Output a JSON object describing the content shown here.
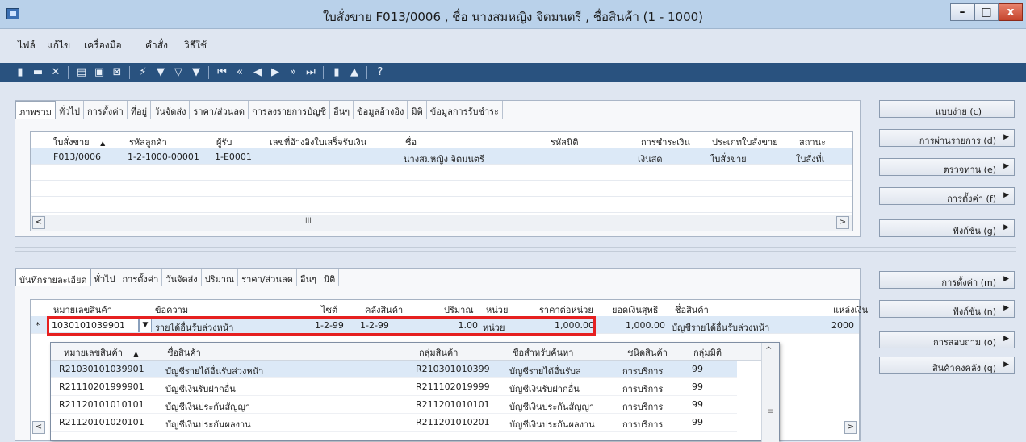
{
  "window": {
    "title": "ใบสั่งขาย F013/0006 , ชื่อ นางสมหญิง จิตมนตรี , ชื่อสินค้า (1 - 1000)",
    "min": "–",
    "max": "□",
    "close": "x"
  },
  "menu": [
    "ไฟล์",
    "แก้ไข",
    "เครื่องมือ",
    "คำสั่ง",
    "วิธีใช้"
  ],
  "toolbar_icons": [
    "new-icon",
    "save-icon",
    "delete-icon",
    "print-icon",
    "print-preview-icon",
    "excel-icon",
    "filter-icon",
    "filter-by-selection-icon",
    "advanced-filter-icon",
    "remove-filter-icon",
    "first-record-icon",
    "prev-page-icon",
    "prev-record-icon",
    "next-record-icon",
    "next-page-icon",
    "last-record-icon",
    "attachment-icon",
    "alert-icon",
    "help-icon"
  ],
  "header_tabs": [
    "ภาพรวม",
    "ทั่วไป",
    "การตั้งค่า",
    "ที่อยู่",
    "วันจัดส่ง",
    "ราคา/ส่วนลด",
    "การลงรายการบัญชี",
    "อื่นๆ",
    "ข้อมูลอ้างอิง",
    "มิติ",
    "ข้อมูลการรับชำระ"
  ],
  "header_grid": {
    "columns": [
      "ใบสั่งขาย",
      "รหัสลูกค้า",
      "ผู้รับ",
      "เลขที่อ้างอิงใบเสร็จรับเงิน",
      "ชื่อ",
      "รหัสนิติ",
      "การชำระเงิน",
      "ประเภทใบสั่งขาย",
      "สถานะ"
    ],
    "sort_indicator": "▲",
    "rows": [
      [
        "F013/0006",
        "1-2-1000-00001",
        "1-E0001",
        "",
        "นางสมหญิง จิตมนตรี",
        "",
        "เงินสด",
        "ใบสั่งขาย",
        "ใบสั่งที่เ"
      ]
    ],
    "scroll_mid": "III"
  },
  "right_buttons_top": [
    {
      "label": "แบบง่าย (c)",
      "arrow": false
    },
    {
      "label": "การผ่านรายการ (d)",
      "arrow": true
    },
    {
      "label": "ตรวจทาน (e)",
      "arrow": true
    },
    {
      "label": "การตั้งค่า (f)",
      "arrow": true
    },
    {
      "label": "ฟังก์ชัน (g)",
      "arrow": true
    }
  ],
  "line_tabs": [
    "บันทึกรายละเอียด",
    "ทั่วไป",
    "การตั้งค่า",
    "วันจัดส่ง",
    "ปริมาณ",
    "ราคา/ส่วนลด",
    "อื่นๆ",
    "มิติ"
  ],
  "line_grid": {
    "columns": [
      "หมายเลขสินค้า",
      "ข้อความ",
      "ไซต์",
      "คลังสินค้า",
      "ปริมาณ",
      "หน่วย",
      "ราคาต่อหน่วย",
      "ยอดเงินสุทธิ",
      "ชื่อสินค้า",
      "แหล่งเงิน"
    ],
    "row_marker": "*",
    "row": {
      "item": "1030101039901",
      "text": "รายได้อื่นรับล่วงหน้า",
      "site": "1-2-99",
      "warehouse": "1-2-99",
      "qty": "1.00",
      "unit": "หน่วย",
      "price": "1,000.00",
      "net": "1,000.00",
      "name": "บัญชีรายได้อื่นรับล่วงหน้า",
      "fund": "2000"
    }
  },
  "lookup": {
    "columns": [
      "หมายเลขสินค้า",
      "ชื่อสินค้า",
      "กลุ่มสินค้า",
      "ชื่อสำหรับค้นหา",
      "ชนิดสินค้า",
      "กลุ่มมิติ"
    ],
    "sort_indicator": "▲",
    "rows": [
      [
        "R21030101039901",
        "บัญชีรายได้อื่นรับล่วงหน้า",
        "R210301010399",
        "บัญชีรายได้อื่นรับล่",
        "การบริการ",
        "99"
      ],
      [
        "R21110201999901",
        "บัญชีเงินรับฝากอื่น",
        "R211102019999",
        "บัญชีเงินรับฝากอื่น",
        "การบริการ",
        "99"
      ],
      [
        "R21120101010101",
        "บัญชีเงินประกันสัญญา",
        "R211201010101",
        "บัญชีเงินประกันสัญญา",
        "การบริการ",
        "99"
      ],
      [
        "R21120101020101",
        "บัญชีเงินประกันผลงาน",
        "R211201010201",
        "บัญชีเงินประกันผลงาน",
        "การบริการ",
        "99"
      ]
    ]
  },
  "right_buttons_bottom": [
    {
      "label": "การตั้งค่า (m)",
      "arrow": true
    },
    {
      "label": "ฟังก์ชัน (n)",
      "arrow": true
    },
    {
      "label": "การสอบถาม (o)",
      "arrow": true
    },
    {
      "label": "สินค้าคงคลัง (q)",
      "arrow": true
    }
  ],
  "colors": {
    "selection_highlight": "#e62020",
    "toolbar_bg": "#29527f",
    "selected_row": "#dce9f7"
  }
}
